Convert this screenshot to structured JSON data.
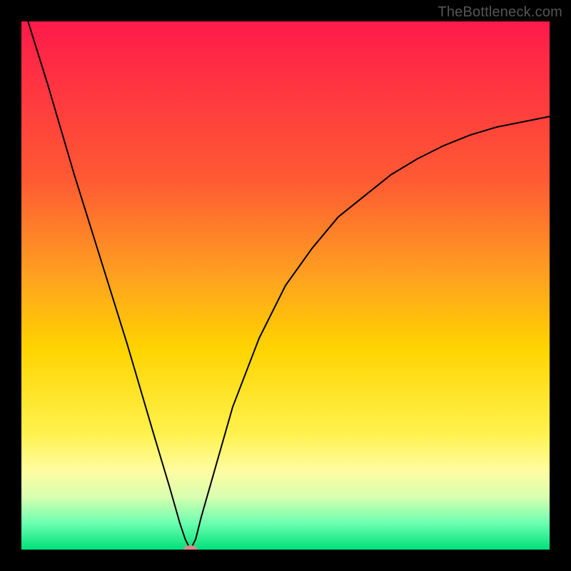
{
  "watermark": "TheBottleneck.com",
  "chart_data": {
    "type": "line",
    "title": "",
    "xlabel": "",
    "ylabel": "",
    "xlim": [
      0,
      100
    ],
    "ylim": [
      0,
      100
    ],
    "legend": false,
    "grid": false,
    "background_gradient_stops": [
      {
        "pos": 0.0,
        "color": "#ff1a4a"
      },
      {
        "pos": 0.3,
        "color": "#ff5a33"
      },
      {
        "pos": 0.48,
        "color": "#ffa020"
      },
      {
        "pos": 0.62,
        "color": "#ffd400"
      },
      {
        "pos": 0.78,
        "color": "#fff24d"
      },
      {
        "pos": 0.85,
        "color": "#fffca0"
      },
      {
        "pos": 0.9,
        "color": "#d9ffb0"
      },
      {
        "pos": 0.95,
        "color": "#6cffb0"
      },
      {
        "pos": 1.0,
        "color": "#00e07a"
      }
    ],
    "series": [
      {
        "name": "bottleneck-curve",
        "stroke": "#000000",
        "stroke_width": 2,
        "x": [
          0,
          5,
          10,
          15,
          20,
          25,
          28,
          30,
          31,
          32,
          33,
          34,
          36,
          40,
          45,
          50,
          55,
          60,
          65,
          70,
          75,
          80,
          85,
          90,
          95,
          100
        ],
        "values": [
          104,
          88,
          71,
          55,
          39,
          22,
          12,
          5,
          2,
          0,
          2,
          6,
          13,
          27,
          40,
          50,
          57,
          63,
          67,
          71,
          74,
          76.5,
          78.5,
          80,
          81,
          82
        ]
      }
    ],
    "marker": {
      "name": "optimal-point",
      "x": 32,
      "y": 0,
      "rx": 10,
      "ry": 6,
      "fill": "#d98a8a"
    }
  }
}
